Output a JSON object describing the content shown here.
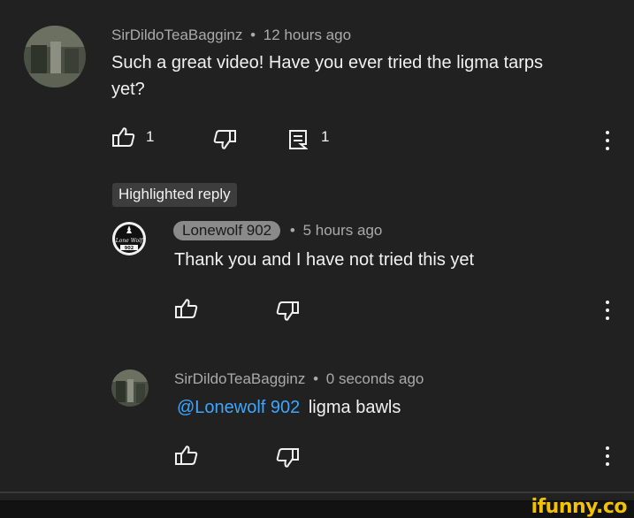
{
  "comments": [
    {
      "author": "SirDildoTeaBagginz",
      "separator": "•",
      "time": "12 hours ago",
      "text_line1": "Such a great video! Have you ever tried the ligma tarps",
      "text_line2": "yet?",
      "likes": "1",
      "replies": "1"
    }
  ],
  "highlighted_label": "Highlighted reply",
  "replies": [
    {
      "author": "Lonewolf 902",
      "separator": "•",
      "time": "5 hours ago",
      "text": "Thank you and I have not tried this yet",
      "avatar_text": "Lone Wolf",
      "avatar_number": "902"
    },
    {
      "author": "SirDildoTeaBagginz",
      "separator": "•",
      "time": "0 seconds ago",
      "mention": "@Lonewolf 902",
      "text": "ligma bawls"
    }
  ],
  "watermark": "ifunny.co",
  "icons": {
    "like": "thumbs-up-icon",
    "dislike": "thumbs-down-icon",
    "reply": "comment-icon",
    "more": "more-vertical-icon"
  }
}
